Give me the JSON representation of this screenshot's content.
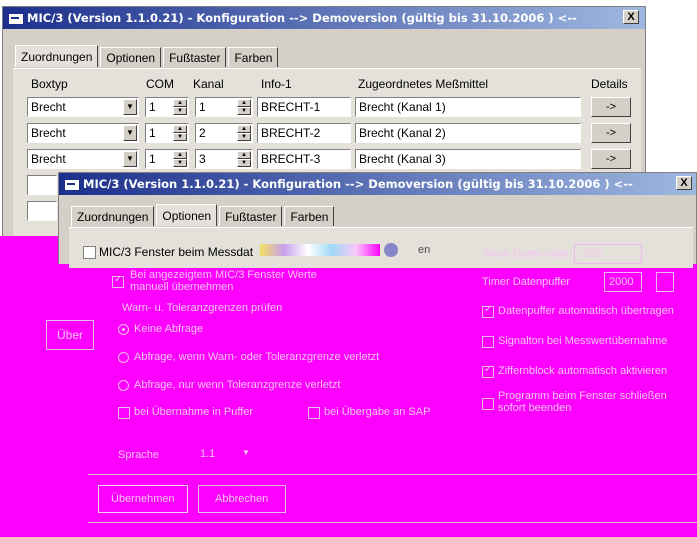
{
  "win1": {
    "title": "MIC/3  (Version 1.1.0.21) - Konfiguration --> Demoversion (gültig bis 31.10.2006 ) <--",
    "close": "X",
    "tabs": [
      "Zuordnungen",
      "Optionen",
      "Fußtaster",
      "Farben"
    ],
    "headers": {
      "boxtyp": "Boxtyp",
      "com": "COM",
      "kanal": "Kanal",
      "info1": "Info-1",
      "mittel": "Zugeordnetes Meßmittel",
      "details": "Details"
    },
    "rows": [
      {
        "boxtyp": "Brecht",
        "com": "1",
        "kanal": "1",
        "info": "BRECHT-1",
        "mittel": "Brecht (Kanal 1)",
        "details": "->"
      },
      {
        "boxtyp": "Brecht",
        "com": "1",
        "kanal": "2",
        "info": "BRECHT-2",
        "mittel": "Brecht (Kanal 2)",
        "details": "->"
      },
      {
        "boxtyp": "Brecht",
        "com": "1",
        "kanal": "3",
        "info": "BRECHT-3",
        "mittel": "Brecht (Kanal 3)",
        "details": "->"
      }
    ],
    "left_button_partial": "Über"
  },
  "win2": {
    "title": "MIC/3  (Version 1.1.0.21) - Konfiguration --> Demoversion (gültig bis 31.10.2006 ) <--",
    "close": "X",
    "tabs": [
      "Zuordnungen",
      "Optionen",
      "Fußtaster",
      "Farben"
    ],
    "checkbox_label": "MIC/3 Fenster beim Messdat",
    "checkbox_suffix": "en",
    "timer_daten_holen": "Timer Daten holen",
    "timer_daten_holen_value": "200",
    "timer_datenpuffer": "Timer Datenpuffer",
    "timer_datenpuffer_value": "2000",
    "check_manual": "Bei angezeigtem MIC/3 Fenster Werte manuell übernehmen",
    "group_label": "Warn- u. Toleranzgrenzen prüfen",
    "radio_none": "Keine Abfrage",
    "radio_warn": "Abfrage, wenn Warn- oder Toleranzgrenze verletzt",
    "radio_tol": "Abfrage, nur wenn Toleranzgrenze verletzt",
    "check_puffer": "bei Übernahme in Puffer",
    "check_sap": "bei Übergabe an SAP",
    "check_datenpuffer": "Datenpuffer automatisch übertragen",
    "check_signalton": "Signalton bei Messwertübernahme",
    "check_ziffernblock": "Ziffernblock automatisch aktivieren",
    "check_programm": "Programm beim Fenster schließen sofort beenden",
    "sprache_label": "Sprache",
    "sprache_value": "1.1",
    "ok_button": "Übernehmen",
    "cancel_button": "Abbrechen"
  }
}
